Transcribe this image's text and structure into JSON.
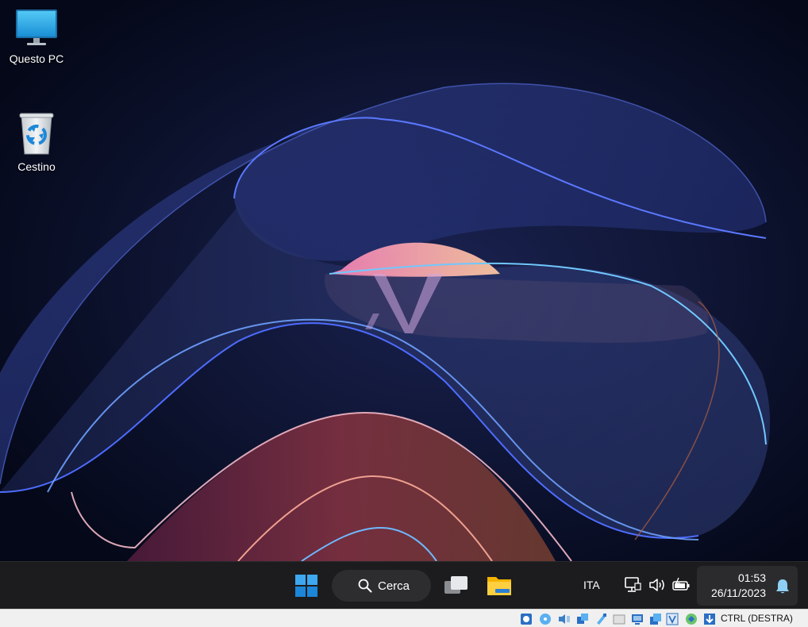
{
  "desktop": {
    "icons": [
      {
        "label": "Questo PC",
        "icon": "monitor-icon"
      },
      {
        "label": "Cestino",
        "icon": "recycle-bin-icon"
      }
    ]
  },
  "taskbar": {
    "search_label": "Cerca",
    "language": "ITA",
    "clock_time": "01:53",
    "clock_date": "26/11/2023",
    "pinned": [
      "windows-start-icon",
      "task-view-icon",
      "file-explorer-icon"
    ],
    "tray_icons": [
      "network-icon",
      "volume-icon",
      "battery-icon",
      "notification-bell-icon"
    ]
  },
  "vbox_status": {
    "host_key": "CTRL (DESTRA)",
    "icons": [
      "hard-disk-icon",
      "optical-drive-icon",
      "audio-icon",
      "network-adapters-icon",
      "usb-icon",
      "shared-folders-icon",
      "display-icon",
      "recording-icon",
      "vt-x-icon",
      "mouse-integration-icon",
      "keyboard-capture-icon"
    ]
  },
  "colors": {
    "taskbar_bg": "#1c1c1e",
    "accent_blue": "#0078d4",
    "desktop_bg": "#050a1e"
  }
}
